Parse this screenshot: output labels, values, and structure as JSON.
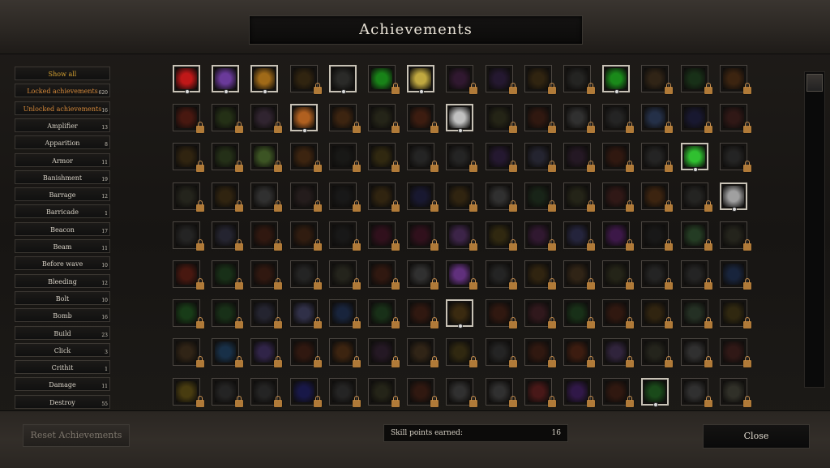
{
  "window": {
    "title": "Achievements"
  },
  "categories": [
    {
      "label": "Show all",
      "count": "",
      "style": "gold"
    },
    {
      "label": "Locked achievements",
      "count": "620",
      "style": "orange"
    },
    {
      "label": "Unlocked achievements",
      "count": "16",
      "style": "orange"
    },
    {
      "label": "Amplifier",
      "count": "13",
      "style": ""
    },
    {
      "label": "Apparition",
      "count": "8",
      "style": ""
    },
    {
      "label": "Armor",
      "count": "11",
      "style": ""
    },
    {
      "label": "Banishment",
      "count": "19",
      "style": ""
    },
    {
      "label": "Barrage",
      "count": "12",
      "style": ""
    },
    {
      "label": "Barricade",
      "count": "1",
      "style": ""
    },
    {
      "label": "Beacon",
      "count": "17",
      "style": ""
    },
    {
      "label": "Beam",
      "count": "11",
      "style": ""
    },
    {
      "label": "Before wave",
      "count": "10",
      "style": ""
    },
    {
      "label": "Bleeding",
      "count": "12",
      "style": ""
    },
    {
      "label": "Bolt",
      "count": "10",
      "style": ""
    },
    {
      "label": "Bomb",
      "count": "16",
      "style": ""
    },
    {
      "label": "Build",
      "count": "23",
      "style": ""
    },
    {
      "label": "Click",
      "count": "3",
      "style": ""
    },
    {
      "label": "Crithit",
      "count": "1",
      "style": ""
    },
    {
      "label": "Damage",
      "count": "11",
      "style": ""
    },
    {
      "label": "Destroy",
      "count": "55",
      "style": ""
    }
  ],
  "achievements": {
    "unlocked": [
      [
        0,
        0
      ],
      [
        0,
        1
      ],
      [
        0,
        2
      ],
      [
        0,
        4
      ],
      [
        0,
        6
      ],
      [
        0,
        11
      ],
      [
        1,
        3
      ],
      [
        1,
        7
      ],
      [
        2,
        13
      ],
      [
        3,
        14
      ],
      [
        6,
        7
      ],
      [
        8,
        12
      ]
    ],
    "colors": [
      [
        "#c01818",
        "#6a3a9a",
        "#a06a18",
        "#3a2a10",
        "#2a2a28",
        "#1aa81a",
        "#c0a840",
        "#3a1a3a",
        "#2a1a3a",
        "#3a2a10",
        "#2a2a28",
        "#1a8a1a",
        "#3a2a18",
        "#1a3a1a",
        "#4a2a10"
      ],
      [
        "#5a1a10",
        "#2a3a18",
        "#3a2a3a",
        "#b06020",
        "#4a2a10",
        "#2a2a1a",
        "#4a2010",
        "#c0c0c0",
        "#2a2a18",
        "#3a1a10",
        "#3a3a3a",
        "#2a2a2a",
        "#2a3a5a",
        "#1a1a3a",
        "#3a1a18"
      ],
      [
        "#3a2a10",
        "#2a3a1a",
        "#4a6a2a",
        "#4a2a10",
        "#1a1a18",
        "#3a3010",
        "#2a2a2a",
        "#2a2a2a",
        "#2a1a3a",
        "#2a2a3a",
        "#2a1a2a",
        "#3a1a10",
        "#2a2a2a",
        "#30c030",
        "#2a2a2a"
      ],
      [
        "#2a2a20",
        "#3a2a10",
        "#3a3a3a",
        "#2a2020",
        "#1a1a1a",
        "#3a2a10",
        "#1a1a3a",
        "#3a2a10",
        "#3a3a3a",
        "#1a2a1a",
        "#2a2a1a",
        "#3a1a18",
        "#4a2a10",
        "#2a2a28",
        "#a0a0a0"
      ],
      [
        "#2a2a2a",
        "#2a2a3a",
        "#3a1a10",
        "#3a2010",
        "#1a1a1a",
        "#3a1020",
        "#3a1020",
        "#4a2a5a",
        "#3a3010",
        "#3a1a3a",
        "#2a2a4a",
        "#4a1a5a",
        "#1a1a1a",
        "#2a4a2a",
        "#2a2a20"
      ],
      [
        "#5a1a10",
        "#1a3a1a",
        "#3a1a10",
        "#2a2a2a",
        "#2a2a20",
        "#3a1a10",
        "#3a3a3a",
        "#7a3aa0",
        "#2a2a2a",
        "#3a2a10",
        "#3a2a18",
        "#2a2a1a",
        "#2a2a2a",
        "#2a2a2a",
        "#1a2a4a"
      ],
      [
        "#1a4a1a",
        "#1a3a1a",
        "#2a2a3a",
        "#3a3a5a",
        "#1a2a4a",
        "#1a3a1a",
        "#3a1a10",
        "#3a2a10",
        "#3a1a10",
        "#3a1a20",
        "#1a3a1a",
        "#3a1a10",
        "#3a2a10",
        "#2a3a2a",
        "#3a3010"
      ],
      [
        "#3a2a18",
        "#1a3a5a",
        "#3a2a5a",
        "#3a1a10",
        "#4a2a10",
        "#2a1a2a",
        "#3a2a18",
        "#3a3010",
        "#2a2a2a",
        "#3a1a10",
        "#4a2010",
        "#3a2a4a",
        "#2a2a20",
        "#3a3a3a",
        "#3a1a18"
      ],
      [
        "#5a4a10",
        "#2a2a2a",
        "#2a2a2a",
        "#1a1a5a",
        "#2a2a2a",
        "#2a2a1a",
        "#3a1a10",
        "#3a3a3a",
        "#3a3a3a",
        "#5a1a1a",
        "#3a1a5a",
        "#3a1a10",
        "#1a4a1a",
        "#3a3a3a",
        "#3a3a30"
      ]
    ]
  },
  "scrollbar": {
    "position": 0
  },
  "footer": {
    "reset_label": "Reset Achievements",
    "skill_points_label": "Skill points earned:",
    "skill_points_value": "16",
    "close_label": "Close"
  }
}
